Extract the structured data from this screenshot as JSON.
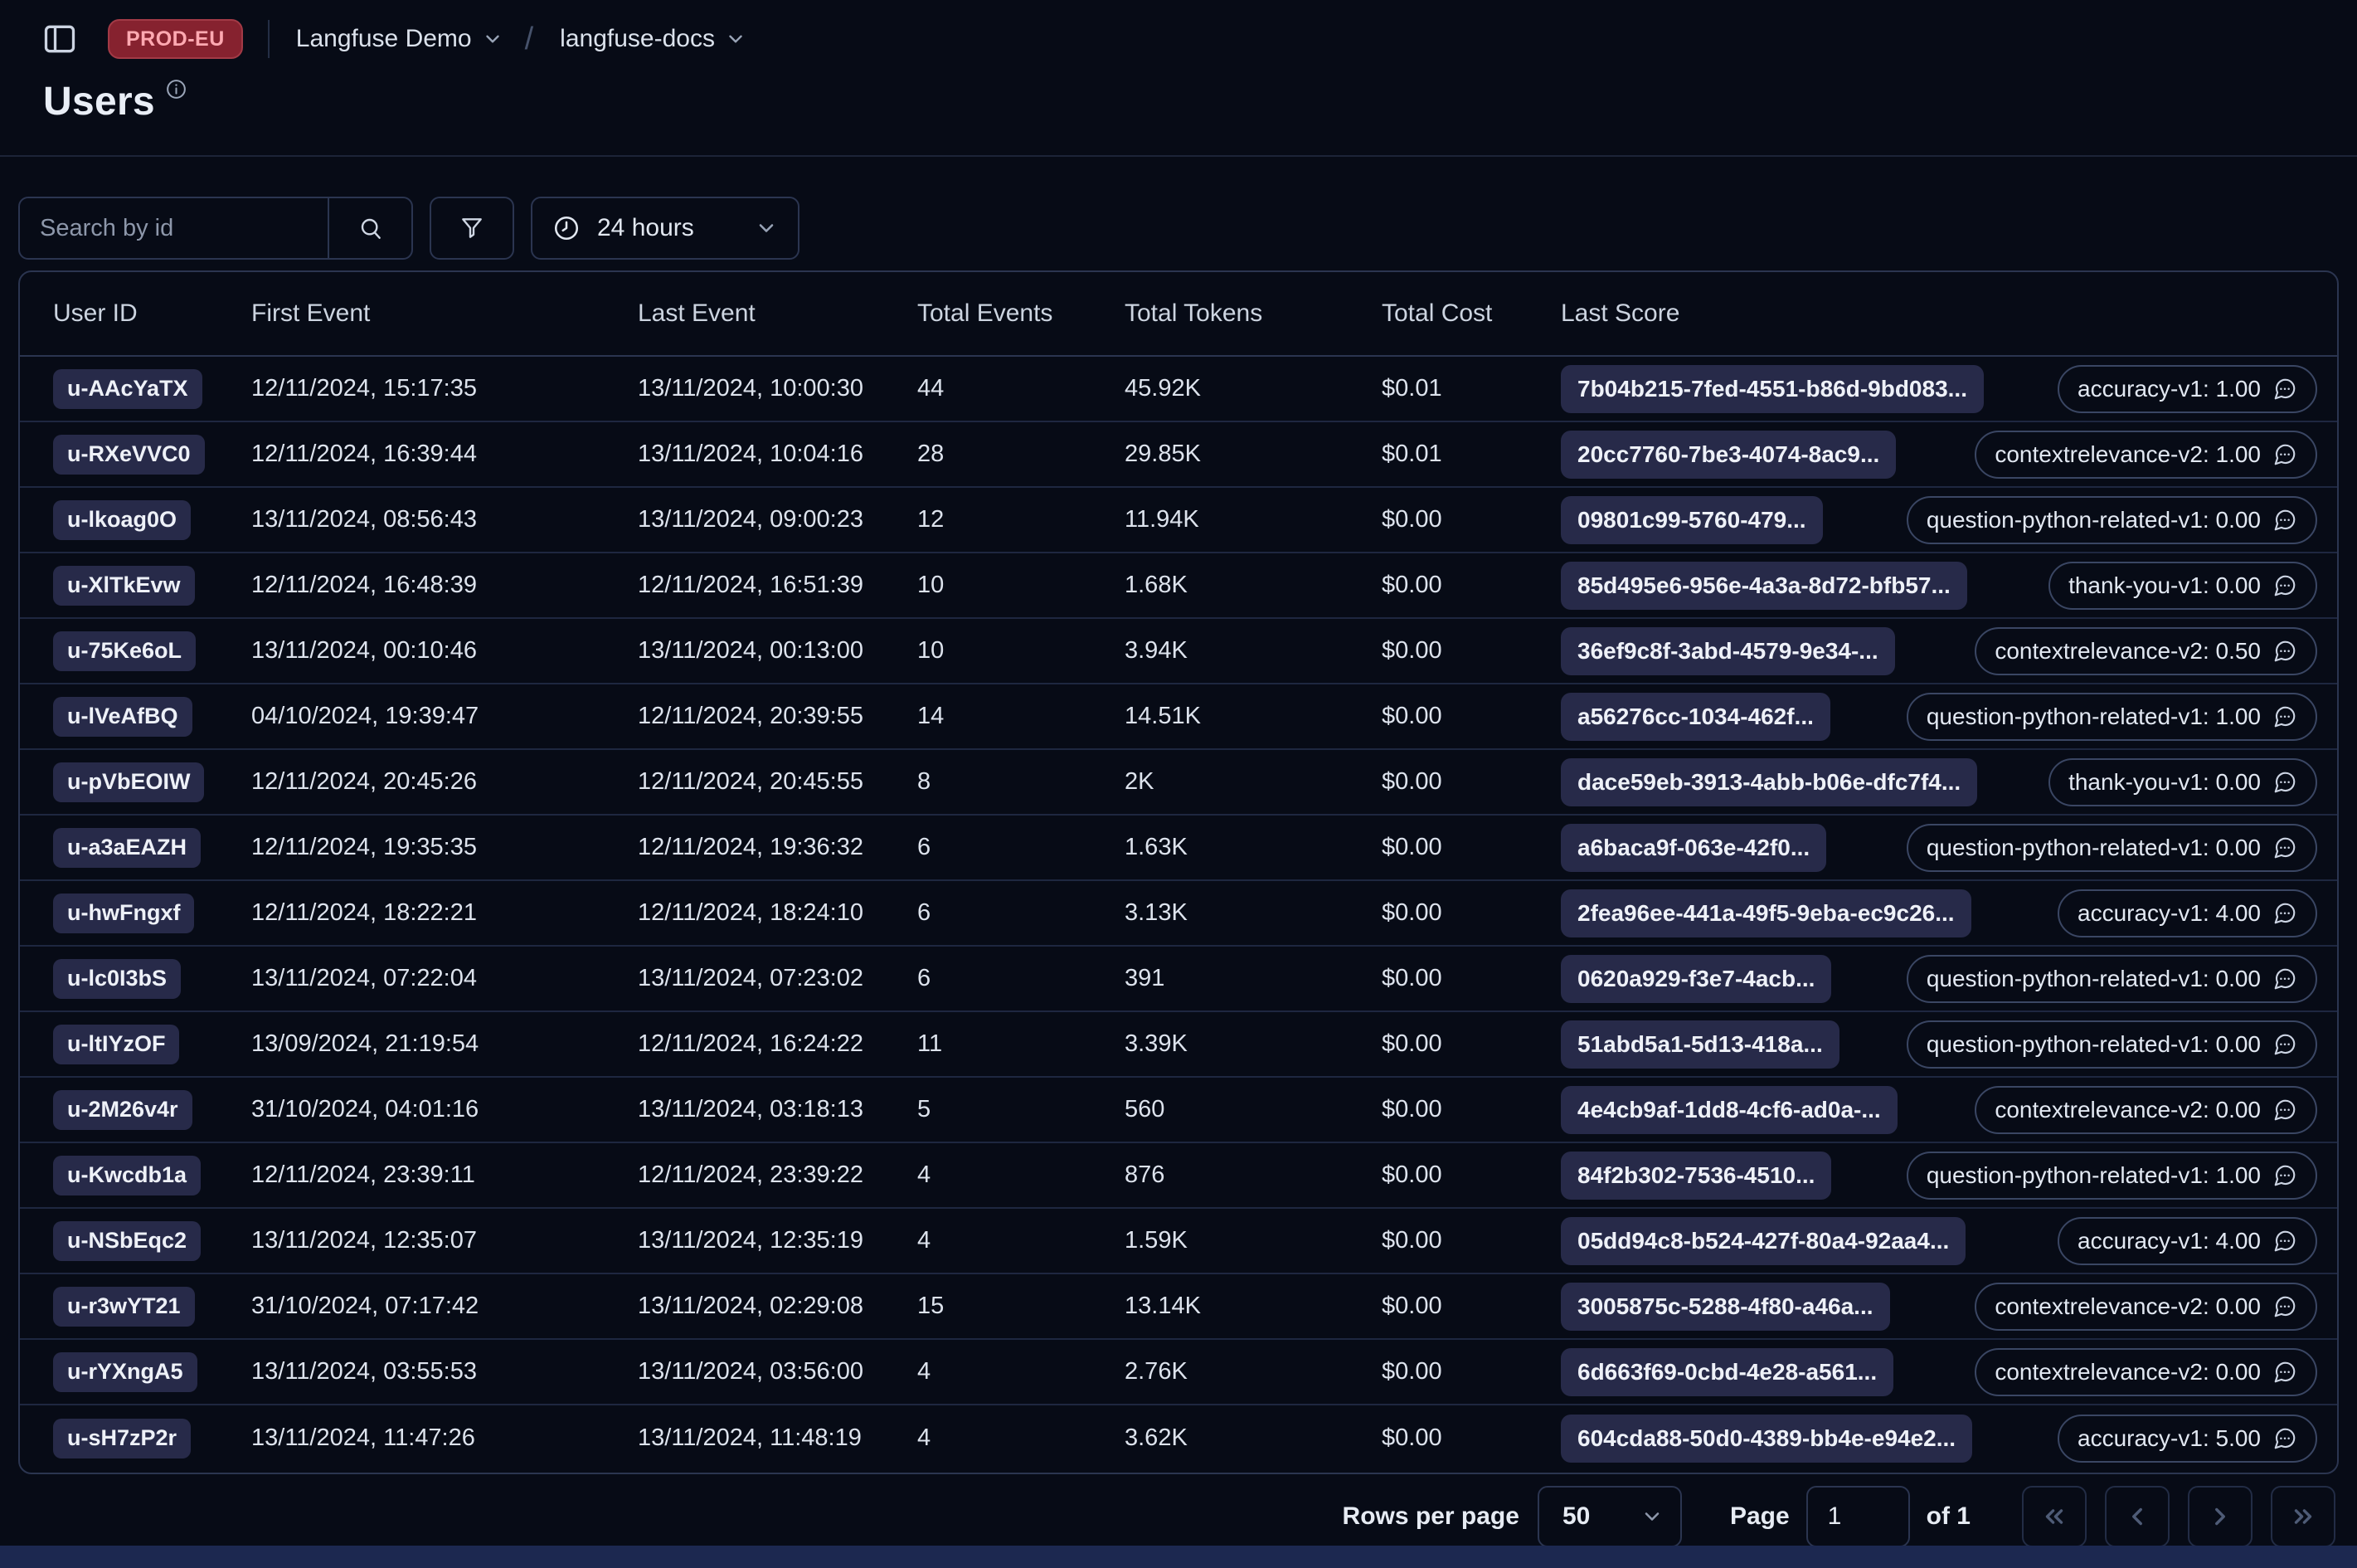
{
  "header": {
    "env_badge": "PROD-EU",
    "breadcrumb": {
      "org": "Langfuse Demo",
      "separator": "/",
      "project": "langfuse-docs"
    },
    "page_title": "Users"
  },
  "toolbar": {
    "search_placeholder": "Search by id",
    "time_range": "24 hours"
  },
  "table": {
    "columns": [
      "User ID",
      "First Event",
      "Last Event",
      "Total Events",
      "Total Tokens",
      "Total Cost",
      "Last Score"
    ],
    "rows": [
      {
        "user_id": "u-AAcYaTX",
        "first_event": "12/11/2024, 15:17:35",
        "last_event": "13/11/2024, 10:00:30",
        "total_events": "44",
        "total_tokens": "45.92K",
        "total_cost": "$0.01",
        "score_trace_id": "7b04b215-7fed-4551-b86d-9bd083...",
        "last_score": "accuracy-v1: 1.00"
      },
      {
        "user_id": "u-RXeVVC0",
        "first_event": "12/11/2024, 16:39:44",
        "last_event": "13/11/2024, 10:04:16",
        "total_events": "28",
        "total_tokens": "29.85K",
        "total_cost": "$0.01",
        "score_trace_id": "20cc7760-7be3-4074-8ac9...",
        "last_score": "contextrelevance-v2: 1.00"
      },
      {
        "user_id": "u-lkoag0O",
        "first_event": "13/11/2024, 08:56:43",
        "last_event": "13/11/2024, 09:00:23",
        "total_events": "12",
        "total_tokens": "11.94K",
        "total_cost": "$0.00",
        "score_trace_id": "09801c99-5760-479...",
        "last_score": "question-python-related-v1: 0.00"
      },
      {
        "user_id": "u-XlTkEvw",
        "first_event": "12/11/2024, 16:48:39",
        "last_event": "12/11/2024, 16:51:39",
        "total_events": "10",
        "total_tokens": "1.68K",
        "total_cost": "$0.00",
        "score_trace_id": "85d495e6-956e-4a3a-8d72-bfb57...",
        "last_score": "thank-you-v1: 0.00"
      },
      {
        "user_id": "u-75Ke6oL",
        "first_event": "13/11/2024, 00:10:46",
        "last_event": "13/11/2024, 00:13:00",
        "total_events": "10",
        "total_tokens": "3.94K",
        "total_cost": "$0.00",
        "score_trace_id": "36ef9c8f-3abd-4579-9e34-...",
        "last_score": "contextrelevance-v2: 0.50"
      },
      {
        "user_id": "u-lVeAfBQ",
        "first_event": "04/10/2024, 19:39:47",
        "last_event": "12/11/2024, 20:39:55",
        "total_events": "14",
        "total_tokens": "14.51K",
        "total_cost": "$0.00",
        "score_trace_id": "a56276cc-1034-462f...",
        "last_score": "question-python-related-v1: 1.00"
      },
      {
        "user_id": "u-pVbEOIW",
        "first_event": "12/11/2024, 20:45:26",
        "last_event": "12/11/2024, 20:45:55",
        "total_events": "8",
        "total_tokens": "2K",
        "total_cost": "$0.00",
        "score_trace_id": "dace59eb-3913-4abb-b06e-dfc7f4...",
        "last_score": "thank-you-v1: 0.00"
      },
      {
        "user_id": "u-a3aEAZH",
        "first_event": "12/11/2024, 19:35:35",
        "last_event": "12/11/2024, 19:36:32",
        "total_events": "6",
        "total_tokens": "1.63K",
        "total_cost": "$0.00",
        "score_trace_id": "a6baca9f-063e-42f0...",
        "last_score": "question-python-related-v1: 0.00"
      },
      {
        "user_id": "u-hwFngxf",
        "first_event": "12/11/2024, 18:22:21",
        "last_event": "12/11/2024, 18:24:10",
        "total_events": "6",
        "total_tokens": "3.13K",
        "total_cost": "$0.00",
        "score_trace_id": "2fea96ee-441a-49f5-9eba-ec9c26...",
        "last_score": "accuracy-v1: 4.00"
      },
      {
        "user_id": "u-lc0I3bS",
        "first_event": "13/11/2024, 07:22:04",
        "last_event": "13/11/2024, 07:23:02",
        "total_events": "6",
        "total_tokens": "391",
        "total_cost": "$0.00",
        "score_trace_id": "0620a929-f3e7-4acb...",
        "last_score": "question-python-related-v1: 0.00"
      },
      {
        "user_id": "u-ltIYzOF",
        "first_event": "13/09/2024, 21:19:54",
        "last_event": "12/11/2024, 16:24:22",
        "total_events": "11",
        "total_tokens": "3.39K",
        "total_cost": "$0.00",
        "score_trace_id": "51abd5a1-5d13-418a...",
        "last_score": "question-python-related-v1: 0.00"
      },
      {
        "user_id": "u-2M26v4r",
        "first_event": "31/10/2024, 04:01:16",
        "last_event": "13/11/2024, 03:18:13",
        "total_events": "5",
        "total_tokens": "560",
        "total_cost": "$0.00",
        "score_trace_id": "4e4cb9af-1dd8-4cf6-ad0a-...",
        "last_score": "contextrelevance-v2: 0.00"
      },
      {
        "user_id": "u-Kwcdb1a",
        "first_event": "12/11/2024, 23:39:11",
        "last_event": "12/11/2024, 23:39:22",
        "total_events": "4",
        "total_tokens": "876",
        "total_cost": "$0.00",
        "score_trace_id": "84f2b302-7536-4510...",
        "last_score": "question-python-related-v1: 1.00"
      },
      {
        "user_id": "u-NSbEqc2",
        "first_event": "13/11/2024, 12:35:07",
        "last_event": "13/11/2024, 12:35:19",
        "total_events": "4",
        "total_tokens": "1.59K",
        "total_cost": "$0.00",
        "score_trace_id": "05dd94c8-b524-427f-80a4-92aa4...",
        "last_score": "accuracy-v1: 4.00"
      },
      {
        "user_id": "u-r3wYT21",
        "first_event": "31/10/2024, 07:17:42",
        "last_event": "13/11/2024, 02:29:08",
        "total_events": "15",
        "total_tokens": "13.14K",
        "total_cost": "$0.00",
        "score_trace_id": "3005875c-5288-4f80-a46a...",
        "last_score": "contextrelevance-v2: 0.00"
      },
      {
        "user_id": "u-rYXngA5",
        "first_event": "13/11/2024, 03:55:53",
        "last_event": "13/11/2024, 03:56:00",
        "total_events": "4",
        "total_tokens": "2.76K",
        "total_cost": "$0.00",
        "score_trace_id": "6d663f69-0cbd-4e28-a561...",
        "last_score": "contextrelevance-v2: 0.00"
      },
      {
        "user_id": "u-sH7zP2r",
        "first_event": "13/11/2024, 11:47:26",
        "last_event": "13/11/2024, 11:48:19",
        "total_events": "4",
        "total_tokens": "3.62K",
        "total_cost": "$0.00",
        "score_trace_id": "604cda88-50d0-4389-bb4e-e94e2...",
        "last_score": "accuracy-v1: 5.00"
      }
    ]
  },
  "pagination": {
    "rows_per_page_label": "Rows per page",
    "rows_per_page_value": "50",
    "page_label": "Page",
    "page_value": "1",
    "of_label": "of 1"
  },
  "icons": {
    "sidebar_toggle": "panel-left-icon",
    "title_info": "info-icon",
    "search": "search-icon",
    "filter": "funnel-icon",
    "time": "clock-icon",
    "score_comment": "comment-bubble-icon"
  },
  "colors": {
    "background": "#070b16",
    "env_badge_bg": "#86222f",
    "env_badge_text": "#ffa9b1",
    "id_badge_bg": "#272a49",
    "pill_border": "#3a4663",
    "table_border": "#2b3550",
    "row_divider": "#1e2740",
    "footer_strip": "#1c2850"
  }
}
